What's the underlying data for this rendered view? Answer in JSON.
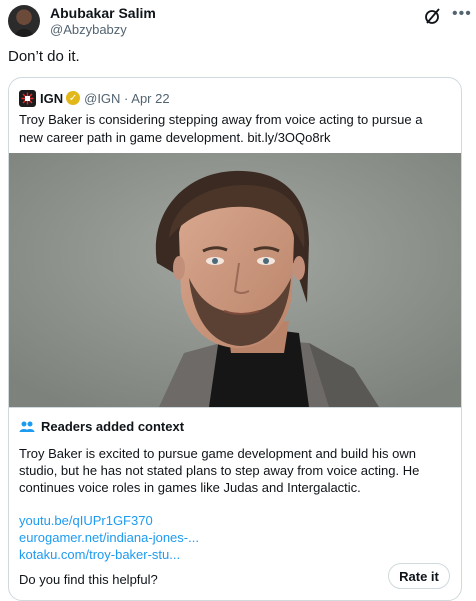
{
  "author": {
    "name": "Abubakar Salim",
    "handle": "@Abzybabzy"
  },
  "tweet": {
    "text": "Don’t do it."
  },
  "quoted": {
    "name": "IGN",
    "handle": "@IGN · Apr 22",
    "text": "Troy Baker is considering stepping away from voice acting to pursue a new career path in game development. bit.ly/3OQo8rk",
    "logo_text": "IGN"
  },
  "context": {
    "title": "Readers added context",
    "body": "Troy Baker is excited to pursue game development and build his own studio, but he has not stated plans to step away from voice acting. He continues voice roles in games like Judas and Intergalactic.",
    "links": [
      "youtu.be/qIUPr1GF370",
      "eurogamer.net/indiana-jones-...",
      "kotaku.com/troy-baker-stu..."
    ],
    "question": "Do you find this helpful?",
    "rate_label": "Rate it"
  },
  "icons": {
    "more": "more-icon",
    "grok": "grok-icon",
    "verified": "verified-badge-icon",
    "readers": "people-icon"
  },
  "colors": {
    "link": "#1d9bf0",
    "text": "#0f1419",
    "muted": "#536471",
    "border": "#cfd9de",
    "verified": "#e2b719"
  }
}
